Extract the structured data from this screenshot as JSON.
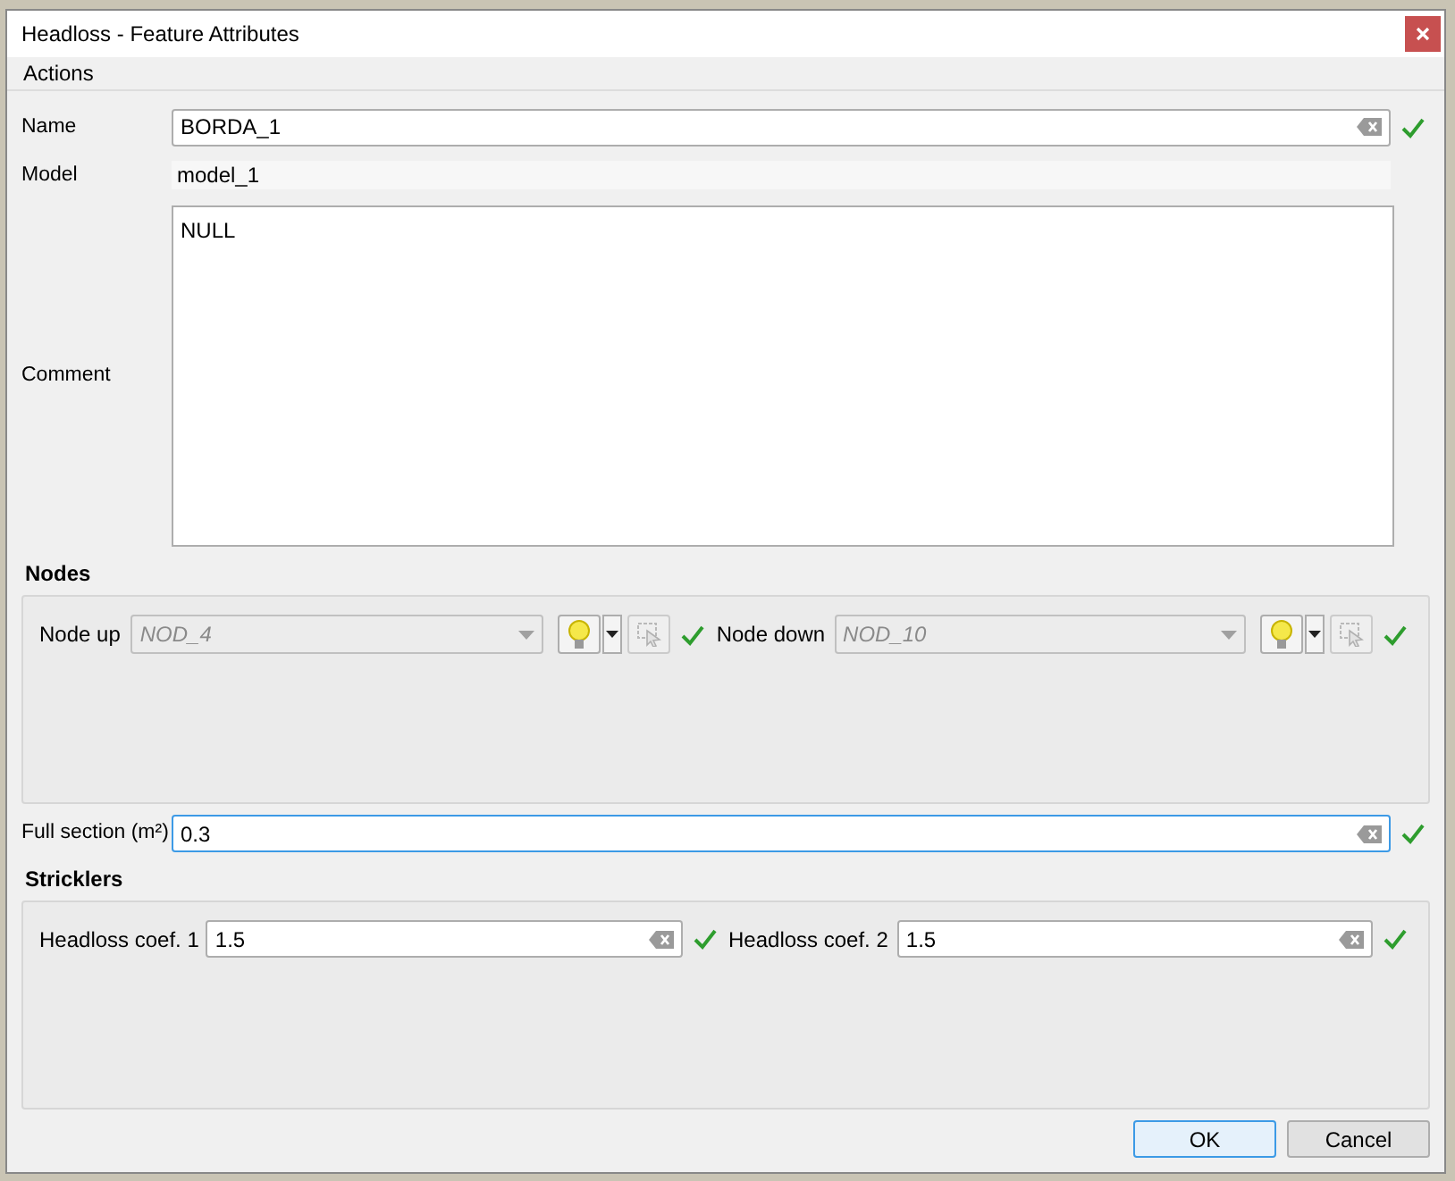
{
  "window": {
    "title": "Headloss - Feature Attributes"
  },
  "menu": [
    {
      "label": "Actions"
    }
  ],
  "fields": [
    {
      "label": "Name",
      "kind": "text",
      "value": "BORDA_1",
      "valid": true,
      "focused": false
    },
    {
      "label": "Model",
      "kind": "readonly",
      "value": "model_1"
    },
    {
      "label": "Comment",
      "kind": "textarea",
      "value": "NULL"
    }
  ],
  "nodes": {
    "title": "Nodes",
    "items": [
      {
        "label": "Node up",
        "value": "NOD_4",
        "disabled": true,
        "valid": true
      },
      {
        "label": "Node down",
        "value": "NOD_10",
        "disabled": true,
        "valid": true
      }
    ]
  },
  "full_section": {
    "label": "Full section (m²)",
    "value": "0.3",
    "focused": true,
    "valid": true
  },
  "stricklers": {
    "title": "Stricklers",
    "items": [
      {
        "label": "Headloss coef. 1",
        "value": "1.5",
        "valid": true
      },
      {
        "label": "Headloss coef. 2",
        "value": "1.5",
        "valid": true
      }
    ]
  },
  "buttons": [
    {
      "label": "OK",
      "default": true
    },
    {
      "label": "Cancel",
      "default": false
    }
  ]
}
